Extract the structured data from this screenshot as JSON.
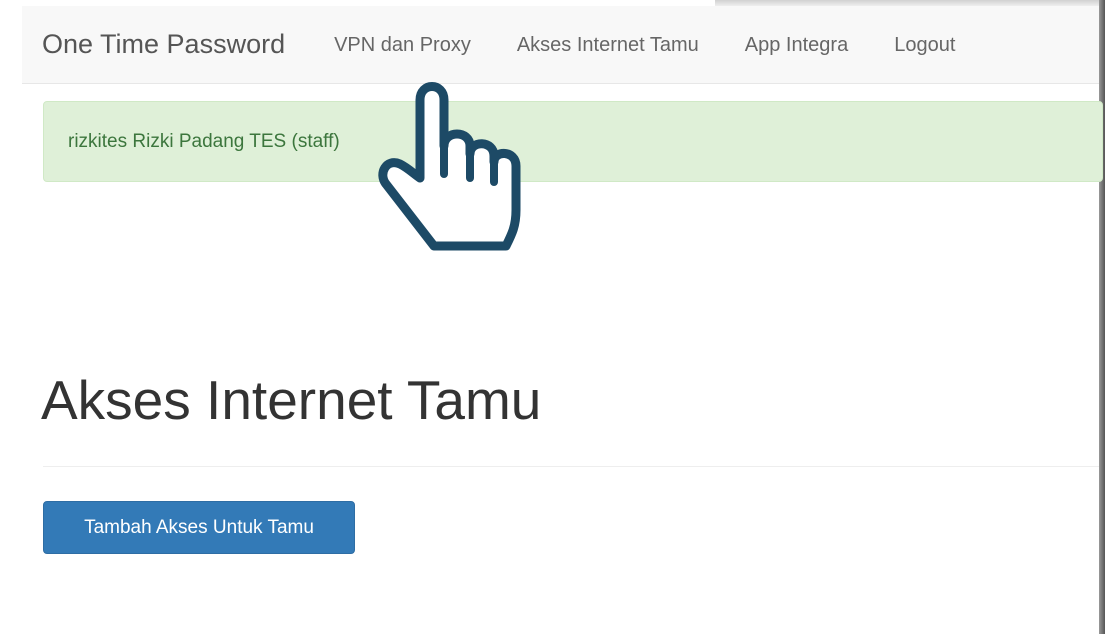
{
  "navbar": {
    "brand": "One Time Password",
    "links": [
      {
        "label": "VPN dan Proxy"
      },
      {
        "label": "Akses Internet Tamu"
      },
      {
        "label": "App Integra"
      },
      {
        "label": "Logout"
      }
    ]
  },
  "alert": {
    "text": "rizkites Rizki Padang TES (staff)",
    "color": "#dff0d8"
  },
  "main": {
    "title": "Akses Internet Tamu",
    "add_button_label": "Tambah Akses Untuk Tamu"
  },
  "overlay": {
    "icon": "pointing-hand-icon"
  },
  "colors": {
    "primary": "#337ab7",
    "success_text": "#3c763d",
    "hand_stroke": "#1d4a66"
  }
}
